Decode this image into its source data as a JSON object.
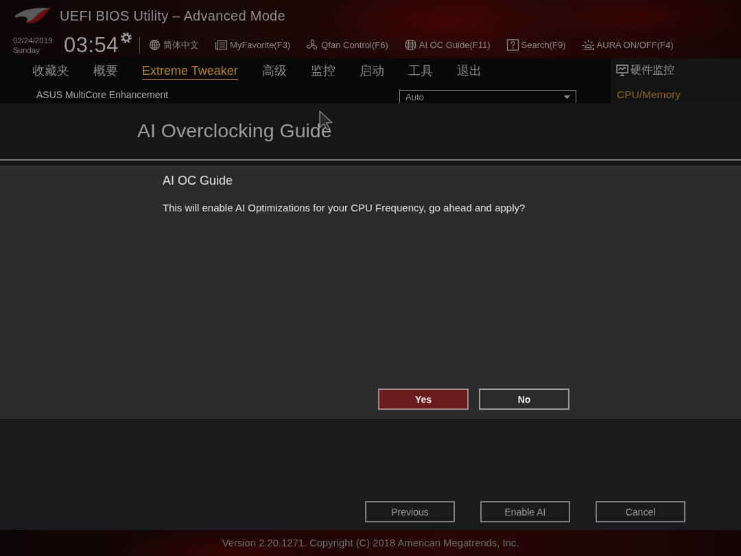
{
  "header": {
    "title": "UEFI BIOS Utility – Advanced Mode",
    "date": "02/24/2019",
    "weekday": "Sunday",
    "time": "03:54",
    "toolbar": [
      {
        "kind": "language",
        "label": "简体中文"
      },
      {
        "kind": "favorite",
        "label": "MyFavorite(F3)"
      },
      {
        "kind": "fan",
        "label": "Qfan Control(F6)"
      },
      {
        "kind": "ai",
        "label": "AI OC Guide(F11)"
      },
      {
        "kind": "search",
        "label": "Search(F9)"
      },
      {
        "kind": "aura",
        "label": "AURA ON/OFF(F4)"
      }
    ]
  },
  "tabs": [
    {
      "label": "收藏夹",
      "selected": false
    },
    {
      "label": "概要",
      "selected": false
    },
    {
      "label": "Extreme Tweaker",
      "selected": true
    },
    {
      "label": "高级",
      "selected": false
    },
    {
      "label": "监控",
      "selected": false
    },
    {
      "label": "启动",
      "selected": false
    },
    {
      "label": "工具",
      "selected": false
    },
    {
      "label": "退出",
      "selected": false
    }
  ],
  "settings": [
    {
      "label": "ASUS MultiCore Enhancement",
      "value": "Auto"
    }
  ],
  "hardware_monitor": {
    "title": "硬件监控",
    "section": "CPU/Memory"
  },
  "wizard": {
    "title": "AI Overclocking Guide",
    "dialog": {
      "title": "AI OC Guide",
      "message": "This will enable AI Optimizations for your CPU Frequency, go ahead and apply?",
      "buttons": [
        {
          "label": "Yes",
          "selected": true
        },
        {
          "label": "No",
          "selected": false
        }
      ]
    },
    "buttons": [
      {
        "label": "Previous"
      },
      {
        "label": "Enable AI"
      },
      {
        "label": "Cancel"
      }
    ]
  },
  "footer": {
    "text": "Version 2.20.1271. Copyright (C) 2018 American Megatrends, Inc."
  }
}
